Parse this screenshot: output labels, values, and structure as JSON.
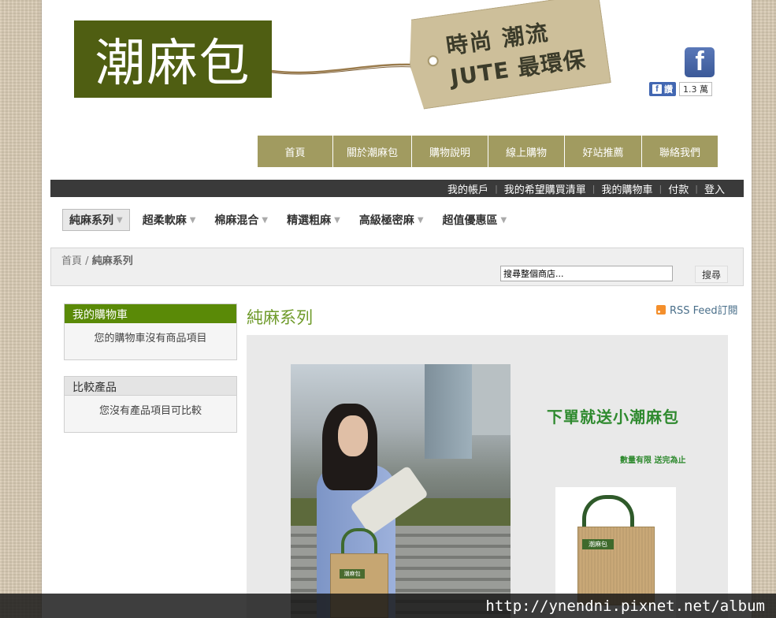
{
  "header": {
    "logo_text": "潮麻包",
    "tag_line1": "時尚 潮流",
    "tag_line2": "JUTE 最環保",
    "fb_like_label": "讚",
    "fb_like_count": "1.3 萬"
  },
  "main_nav": [
    {
      "label": "首頁",
      "width": 96
    },
    {
      "label": "關於潮麻包",
      "width": 100
    },
    {
      "label": "購物說明",
      "width": 97
    },
    {
      "label": "線上購物",
      "width": 97
    },
    {
      "label": "好站推薦",
      "width": 98
    },
    {
      "label": "聯絡我們",
      "width": 97
    }
  ],
  "user_bar": [
    "我的帳戶",
    "我的希望購買清單",
    "我的購物車",
    "付款",
    "登入"
  ],
  "category_nav": [
    {
      "label": "純麻系列",
      "active": true
    },
    {
      "label": "超柔軟麻",
      "active": false
    },
    {
      "label": "棉麻混合",
      "active": false
    },
    {
      "label": "精選粗麻",
      "active": false
    },
    {
      "label": "高級極密麻",
      "active": false
    },
    {
      "label": "超值優惠區",
      "active": false
    }
  ],
  "breadcrumb": {
    "home": "首頁",
    "separator": "/",
    "current": "純麻系列"
  },
  "search": {
    "placeholder": "搜尋整個商店...",
    "button": "搜尋"
  },
  "sidebar": {
    "cart": {
      "title": "我的購物車",
      "empty": "您的購物車沒有商品項目"
    },
    "compare": {
      "title": "比較產品",
      "empty": "您沒有產品項目可比較"
    }
  },
  "content": {
    "title": "純麻系列",
    "rss_label": "RSS Feed訂閱",
    "banner": {
      "headline": "下單就送小潮麻包",
      "subline": "數量有限 送完為止",
      "bag_label": "潮麻包"
    }
  },
  "watermark": "http://ynendni.pixnet.net/album",
  "colors": {
    "logo_bg": "#4f5e12",
    "nav_bg": "#a19b60",
    "cart_title_bg": "#5a8a07",
    "title_green": "#6e9a2a"
  }
}
